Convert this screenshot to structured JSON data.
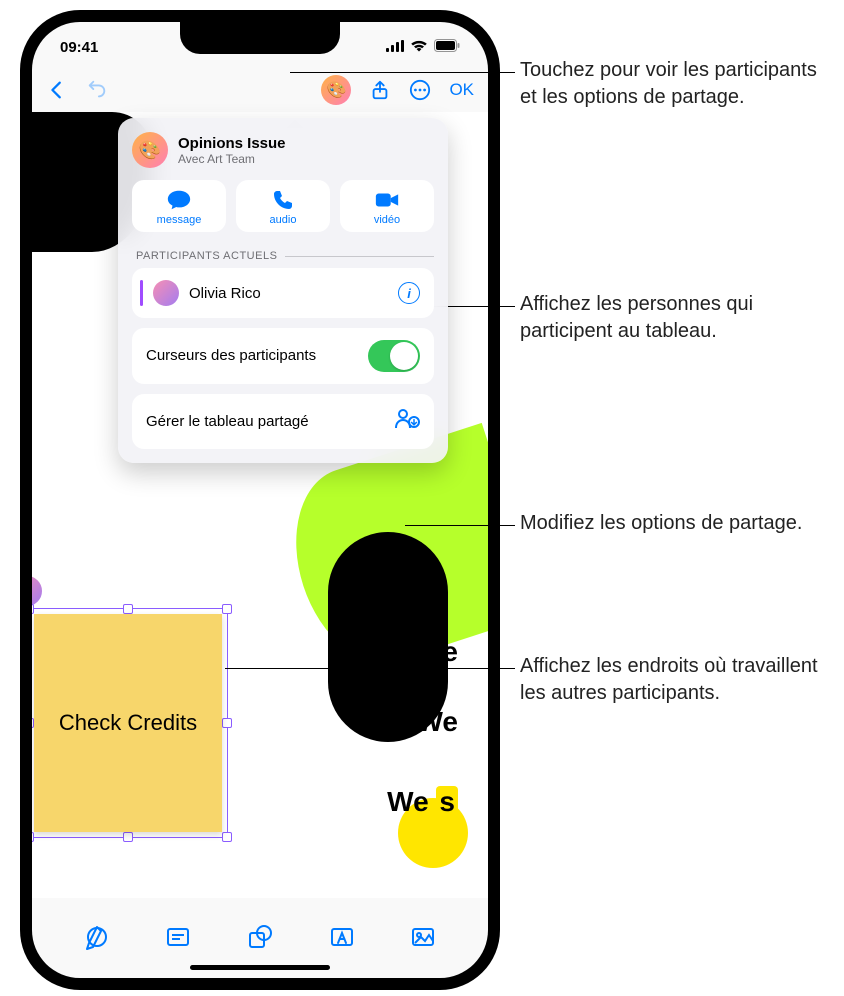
{
  "status": {
    "time": "09:41"
  },
  "toolbar": {
    "ok": "OK"
  },
  "popover": {
    "title": "Opinions Issue",
    "subtitle": "Avec Art Team",
    "contacts": {
      "message": "message",
      "audio": "audio",
      "video": "vidéo"
    },
    "participants_label": "PARTICIPANTS ACTUELS",
    "participants": [
      {
        "name": "Olivia Rico"
      }
    ],
    "cursors_label": "Curseurs des participants",
    "cursors_on": true,
    "manage_label": "Gérer le tableau partagé"
  },
  "canvas": {
    "we1": "We",
    "we2": "We",
    "we3a": "We ",
    "we3b": "s",
    "sticky": "Check Credits"
  },
  "callouts": {
    "c1": "Touchez pour voir les participants et les options de partage.",
    "c2": "Affichez les personnes qui participent au tableau.",
    "c3": "Modifiez les options de partage.",
    "c4": "Affichez les endroits où travaillent les autres participants."
  }
}
